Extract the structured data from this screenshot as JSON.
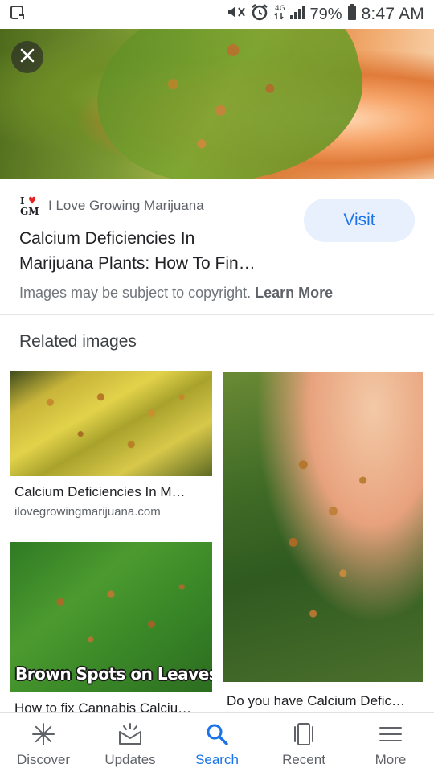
{
  "status_bar": {
    "battery_percent": "79%",
    "time": "8:47 AM",
    "icons": [
      "screenshot-icon",
      "mute-icon",
      "alarm-icon",
      "data-4g-icon",
      "signal-icon",
      "battery-icon"
    ]
  },
  "hero": {
    "close_icon": "close-icon"
  },
  "source": {
    "logo_text_top": "I",
    "logo_text_bottom": "GM",
    "name": "I Love Growing Marijuana"
  },
  "result": {
    "title_line1": "Calcium Deficiencies In",
    "title_line2": "Marijuana Plants: How To Fin…",
    "visit_label": "Visit",
    "copyright_text": "Images may be subject to copyright.",
    "learn_more": "Learn More"
  },
  "related": {
    "heading": "Related images",
    "items": [
      {
        "caption": "Calcium Deficiencies In M…",
        "domain": "ilovegrowingmarijuana.com"
      },
      {
        "caption": "Do you have Calcium Defic…"
      },
      {
        "caption": "How to fix Cannabis Calciu…",
        "overlay_text": "Brown Spots on Leaves"
      }
    ]
  },
  "bottom_nav": {
    "items": [
      {
        "label": "Discover",
        "icon": "discover-icon"
      },
      {
        "label": "Updates",
        "icon": "updates-icon"
      },
      {
        "label": "Search",
        "icon": "search-icon",
        "active": true
      },
      {
        "label": "Recent",
        "icon": "recent-icon"
      },
      {
        "label": "More",
        "icon": "menu-icon"
      }
    ]
  },
  "colors": {
    "accent": "#1a73e8",
    "visit_bg": "#e8f0fe",
    "muted_text": "#5f6368"
  }
}
